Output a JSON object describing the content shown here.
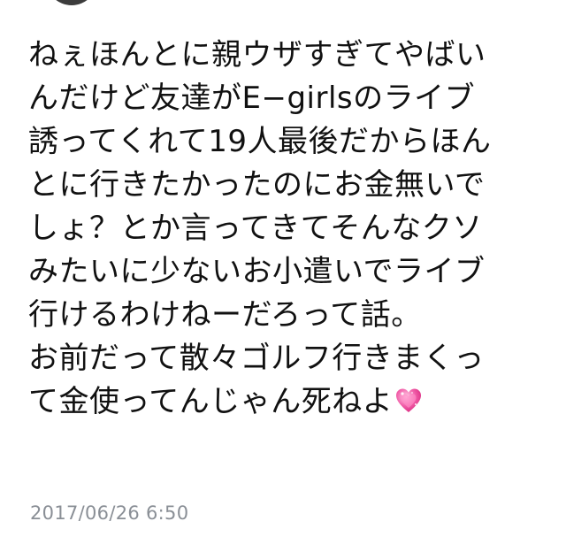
{
  "tweet": {
    "lines": [
      "ねぇほんとに親ウザすぎてやばい",
      "んだけど友達がE−girlsのライブ",
      "誘ってくれて19人最後だからほん",
      "とに行きたかったのにお金無いで",
      "しょ？とか言ってきてそんなクソ",
      "みたいに少ないお小遣いでライブ",
      "行けるわけねーだろって話。",
      "お前だって散々ゴルフ行きまくっ",
      "て金使ってんじゃん死ねよ"
    ],
    "trailing_emoji": "sparkling-heart-icon",
    "timestamp": "2017/06/26 6:50"
  },
  "colors": {
    "text": "#111111",
    "timestamp": "#8a8f96",
    "heart": "#f15da8"
  }
}
